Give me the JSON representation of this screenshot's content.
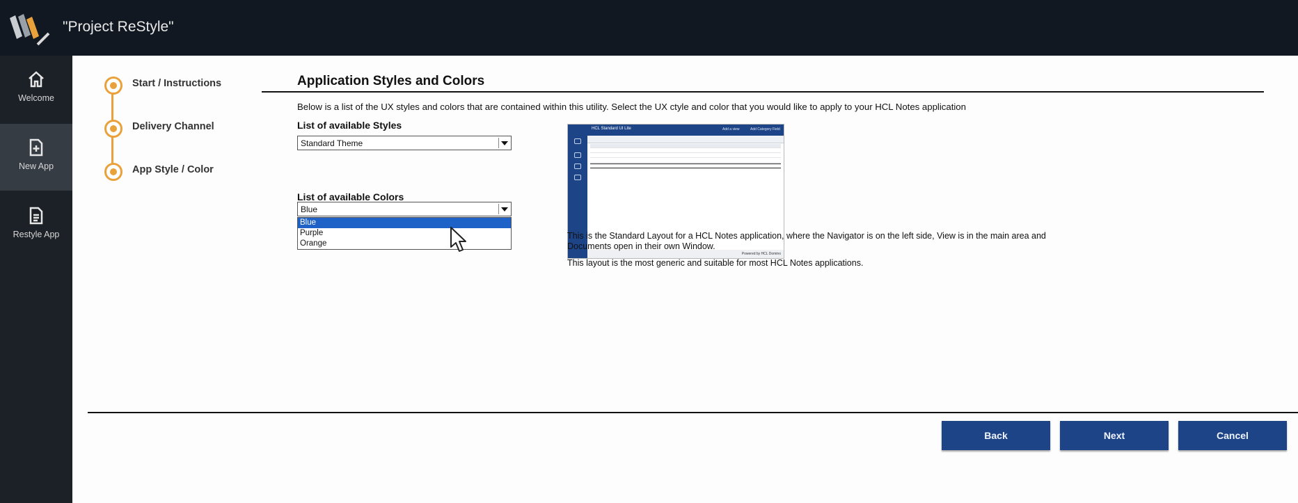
{
  "app": {
    "title": "\"Project ReStyle\""
  },
  "sidebar": {
    "items": [
      {
        "label": "Welcome",
        "icon": "home-icon"
      },
      {
        "label": "New App",
        "icon": "new-document-icon",
        "active": true
      },
      {
        "label": "Restyle App",
        "icon": "document-icon"
      }
    ]
  },
  "steps": [
    {
      "label": "Start / Instructions"
    },
    {
      "label": "Delivery Channel"
    },
    {
      "label": "App Style / Color"
    }
  ],
  "page": {
    "heading": "Application Styles and Colors",
    "intro": "Below is a list of the UX styles and colors that are contained within this utility. Select the UX ctyle and color that you would like to apply to your HCL Notes application",
    "styles_label": "List of available Styles",
    "styles_value": "Standard Theme",
    "colors_label": "List of available Colors",
    "colors_value": "Blue",
    "color_options": [
      "Blue",
      "Purple",
      "Orange"
    ],
    "description": [
      "This is the Standard Layout for a HCL Notes application, where the Navigator is on the left side, View is in the main area and",
      "Documents open in their own Window.",
      "This layout is the most generic and suitable for most HCL Notes applications."
    ]
  },
  "preview": {
    "title": "HCL Standard UI Lite",
    "top_right_1": "Add a view",
    "top_right_2": "Add Category Field",
    "footer": "Powered by HCL Domino"
  },
  "buttons": {
    "back": "Back",
    "next": "Next",
    "cancel": "Cancel"
  },
  "colors": {
    "accent_orange": "#e9a23b",
    "button_blue": "#1e4488",
    "selection_blue": "#1e62c8"
  }
}
